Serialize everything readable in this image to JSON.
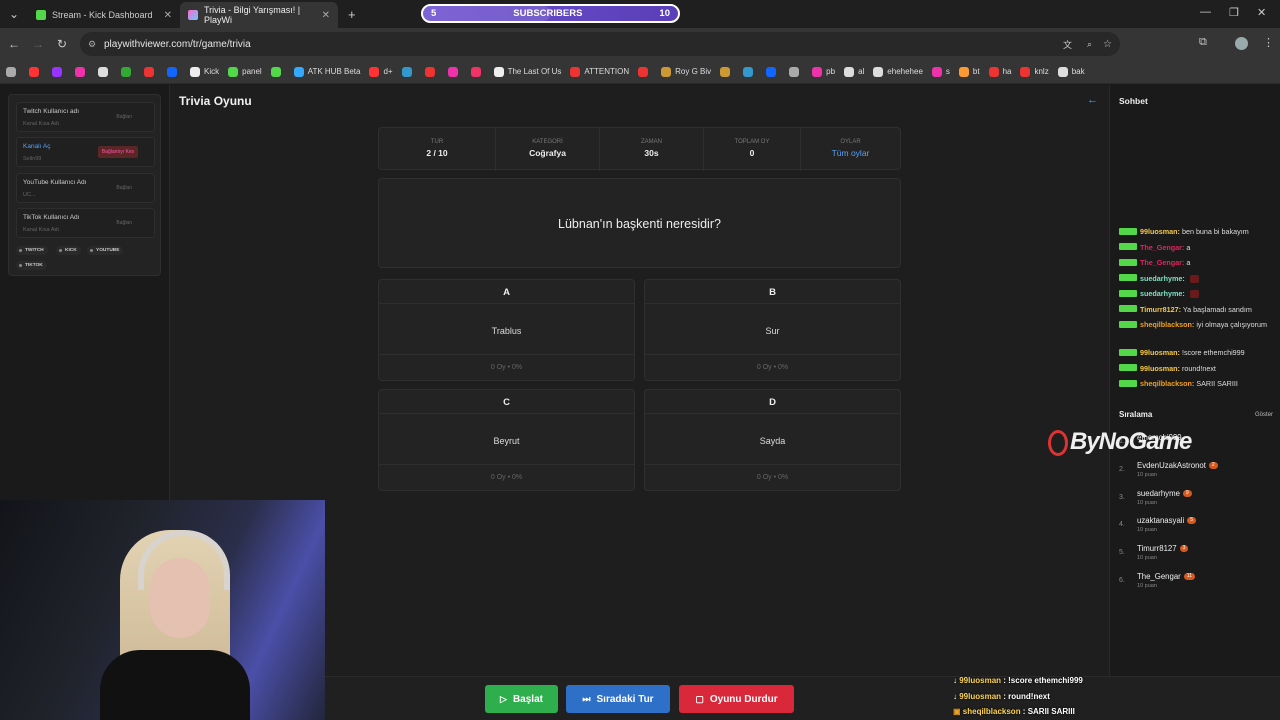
{
  "tabs": [
    {
      "label": "Stream - Kick Dashboard",
      "favicon": "kick-icon"
    },
    {
      "label": "Trivia - Bilgi Yarışması! | PlayWi",
      "favicon": "playwithviewer-icon"
    }
  ],
  "subscribers": {
    "current": "5",
    "label": "SUBSCRIBERS",
    "goal": "10",
    "progress_fraction": 0.5
  },
  "url": "playwithviewer.com/tr/game/trivia",
  "bookmarks": [
    "",
    "",
    "",
    "",
    "",
    "",
    "",
    "",
    "Kick",
    "panel",
    "",
    "ATK HUB Beta",
    "d+",
    "",
    "",
    "",
    "",
    "The Last Of Us",
    "ATTENTION",
    "",
    "Roy G Biv",
    "",
    "",
    "",
    "",
    "pb",
    "al",
    "ehehehee",
    "s",
    "bt",
    "ha",
    "knlz",
    "bak"
  ],
  "left": {
    "rows": [
      {
        "title": "Twitch Kullanıcı adı",
        "sub": "Kanal Kısa Adı",
        "action": "Bağlan"
      },
      {
        "title": "Kanalı Aç",
        "sub": "Selin99",
        "action": "Bağlantıyı Kes"
      },
      {
        "title": "YouTube Kullanıcı Adı",
        "sub": "UC...",
        "action": "Bağlan"
      },
      {
        "title": "TikTok Kullanıcı Adı",
        "sub": "Kanal Kısa Adı",
        "action": "Bağlan"
      }
    ],
    "platforms": [
      "TWITCH",
      "KICK",
      "YOUTUBE",
      "TIKTOK"
    ]
  },
  "game": {
    "title": "Trivia Oyunu",
    "stats": [
      {
        "key": "TUR",
        "value": "2 / 10"
      },
      {
        "key": "KATEGORİ",
        "value": "Coğrafya"
      },
      {
        "key": "ZAMAN",
        "value": "30s"
      },
      {
        "key": "TOPLAM OY",
        "value": "0"
      },
      {
        "key": "OYLAR",
        "value": "Tüm oylar"
      }
    ],
    "question": "Lübnan'ın başkenti neresidir?",
    "options": [
      {
        "letter": "A",
        "answer": "Trablus",
        "votes": "0 Oy • 0%"
      },
      {
        "letter": "B",
        "answer": "Sur",
        "votes": "0 Oy • 0%"
      },
      {
        "letter": "C",
        "answer": "Beyrut",
        "votes": "0 Oy • 0%"
      },
      {
        "letter": "D",
        "answer": "Sayda",
        "votes": "0 Oy • 0%"
      }
    ],
    "buttons": {
      "start": "Başlat",
      "next": "Sıradaki Tur",
      "stop": "Oyunu Durdur"
    }
  },
  "chat": {
    "title": "Sohbet",
    "messages": [
      {
        "user": "99luosman",
        "text": "ben buna bi bakayım",
        "color": "#f7c948"
      },
      {
        "user": "The_Gengar",
        "text": "a",
        "color": "#e0245e"
      },
      {
        "user": "The_Gengar",
        "text": "a",
        "color": "#e0245e"
      },
      {
        "user": "suedarhyme",
        "text": "",
        "color": "#7ee2c3"
      },
      {
        "user": "suedarhyme",
        "text": "",
        "color": "#7ee2c3"
      },
      {
        "user": "Timurr8127",
        "text": "Ya başlamadı sandım",
        "color": "#f7c948"
      },
      {
        "user": "sheqilblackson",
        "text": "iyi olmaya çalışıyorum",
        "color": "#f0a020"
      },
      {
        "user": "99luosman",
        "text": "!score ethemchi999",
        "color": "#f7c948"
      },
      {
        "user": "99luosman",
        "text": "round!next",
        "color": "#f7c948"
      },
      {
        "user": "sheqilblackson",
        "text": "SARII SARIII",
        "color": "#f0a020"
      }
    ]
  },
  "ranking": {
    "title": "Sıralama",
    "show_label": "Göster",
    "items": [
      {
        "n": "1.",
        "name": "ethemchi999",
        "badge": "",
        "pts": ""
      },
      {
        "n": "2.",
        "name": "EvdenUzakAstronot",
        "badge": "2",
        "pts": "10 puan"
      },
      {
        "n": "3.",
        "name": "suedarhyme",
        "badge": "9",
        "pts": "10 puan"
      },
      {
        "n": "4.",
        "name": "uzaktanasyali",
        "badge": "5",
        "pts": "10 puan"
      },
      {
        "n": "5.",
        "name": "Timurr8127",
        "badge": "3",
        "pts": "10 puan"
      },
      {
        "n": "6.",
        "name": "The_Gengar",
        "badge": "11",
        "pts": "10 puan"
      }
    ]
  },
  "watermark": "ByNoGame",
  "overlay_chat": [
    {
      "user": "99luosman",
      "text": "!score ethemchi999"
    },
    {
      "user": "99luosman",
      "text": "round!next"
    },
    {
      "user": "sheqilblackson",
      "text": "SARII SARIII"
    }
  ]
}
